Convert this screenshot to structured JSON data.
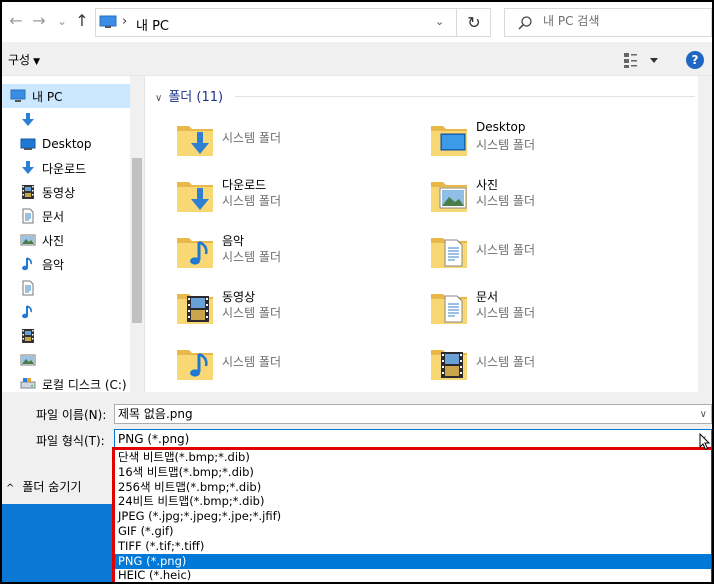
{
  "address_bar": {
    "back": "←",
    "forward": "→",
    "recent": "⌄",
    "up": "↑",
    "crumb": "내 PC",
    "refresh": "↻",
    "search_placeholder": "내 PC 검색"
  },
  "toolbar": {
    "organize_label": "구성",
    "help_label": "?"
  },
  "nav": {
    "items": [
      {
        "label": "내 PC",
        "icon": "pc-icon"
      },
      {
        "label": "",
        "icon": "download-arrow-icon"
      },
      {
        "label": "Desktop",
        "icon": "desktop-icon"
      },
      {
        "label": "다운로드",
        "icon": "download-arrow-icon"
      },
      {
        "label": "동영상",
        "icon": "video-icon"
      },
      {
        "label": "문서",
        "icon": "document-icon"
      },
      {
        "label": "사진",
        "icon": "picture-icon"
      },
      {
        "label": "음악",
        "icon": "music-icon"
      },
      {
        "label": "",
        "icon": "document-icon"
      },
      {
        "label": "",
        "icon": "music-icon"
      },
      {
        "label": "",
        "icon": "video-icon"
      },
      {
        "label": "",
        "icon": "picture-icon"
      },
      {
        "label": "로컬 디스크 (C:)",
        "icon": "drive-icon"
      }
    ]
  },
  "content": {
    "group_title": "폴더 (11)",
    "tiles": [
      {
        "name": "",
        "sub": "시스템 폴더",
        "icon": "download-folder-icon"
      },
      {
        "name": "Desktop",
        "sub": "시스템 폴더",
        "icon": "desktop-folder-icon"
      },
      {
        "name": "다운로드",
        "sub": "시스템 폴더",
        "icon": "download-folder-icon"
      },
      {
        "name": "사진",
        "sub": "시스템 폴더",
        "icon": "picture-folder-icon"
      },
      {
        "name": "음악",
        "sub": "시스템 폴더",
        "icon": "music-folder-icon"
      },
      {
        "name": "",
        "sub": "시스템 폴더",
        "icon": "document-folder-icon"
      },
      {
        "name": "동영상",
        "sub": "시스템 폴더",
        "icon": "video-folder-icon"
      },
      {
        "name": "문서",
        "sub": "시스템 폴더",
        "icon": "document-folder-icon"
      },
      {
        "name": "",
        "sub": "시스템 폴더",
        "icon": "music-folder-icon"
      },
      {
        "name": "",
        "sub": "시스템 폴더",
        "icon": "video-folder-icon"
      }
    ]
  },
  "form": {
    "filename_label": "파일 이름(N):",
    "filename_value": "제목 없음.png",
    "filetype_label": "파일 형식(T):",
    "filetype_value": "PNG (*.png)",
    "hide_folders_label": "폴더 숨기기"
  },
  "filetype_options": [
    "단색 비트맵(*.bmp;*.dib)",
    "16색 비트맵(*.bmp;*.dib)",
    "256색 비트맵(*.bmp;*.dib)",
    "24비트 비트맵(*.bmp;*.dib)",
    "JPEG (*.jpg;*.jpeg;*.jpe;*.jfif)",
    "GIF (*.gif)",
    "TIFF (*.tif;*.tiff)",
    "PNG (*.png)",
    "HEIC (*.heic)"
  ],
  "selected_option_index": 7,
  "colors": {
    "accent": "#0078d7",
    "selection_nav": "#cce8ff",
    "highlight_box": "#e00000",
    "folder": "#f8d775"
  }
}
